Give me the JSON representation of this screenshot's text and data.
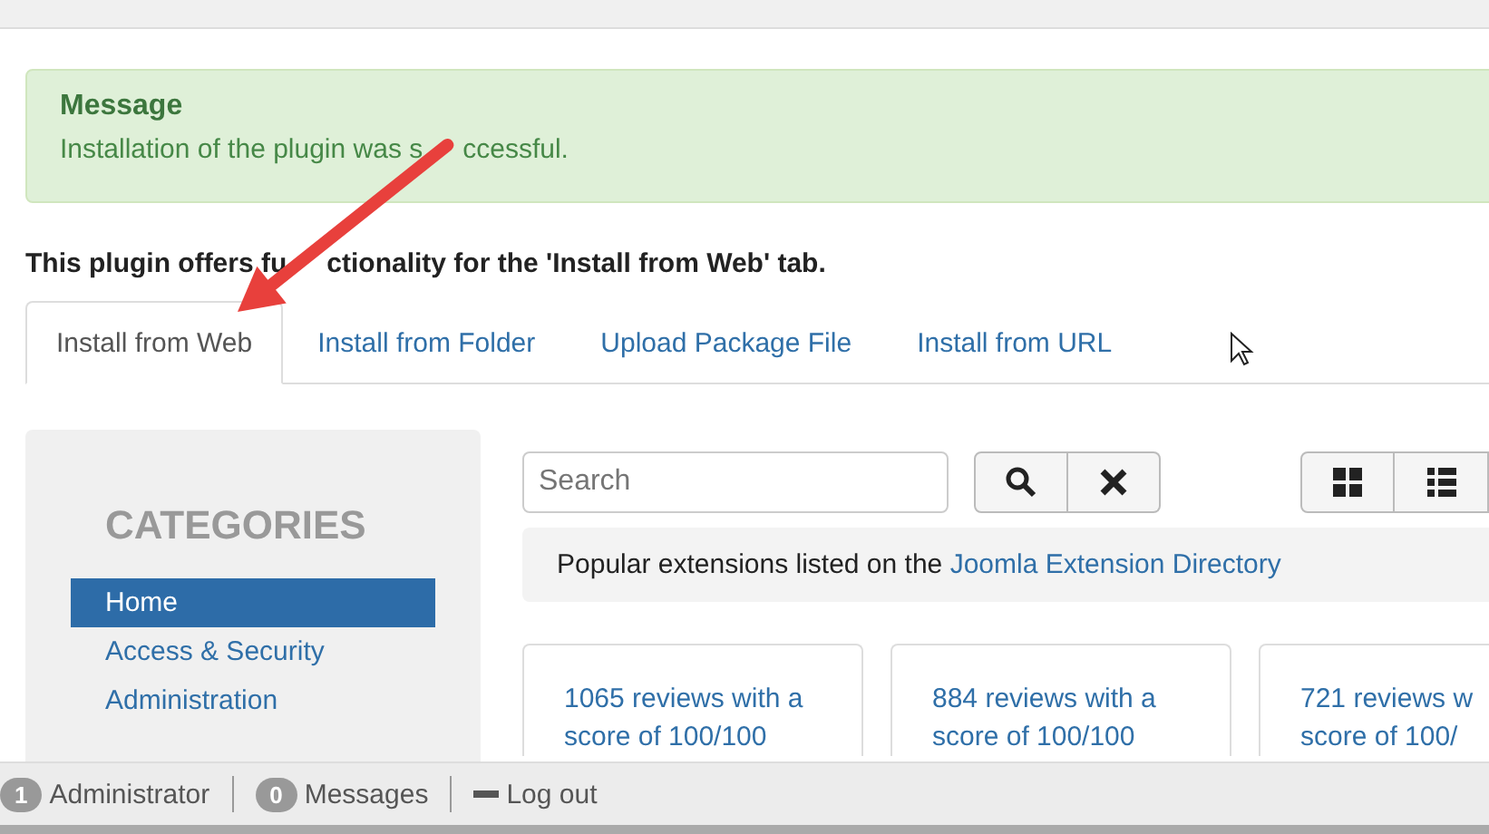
{
  "message": {
    "title": "Message",
    "text_parts": [
      "Installation of the plugin was s",
      "ccessful."
    ]
  },
  "plugin_note_parts": [
    "This plugin offers fu",
    "ctionality for the 'Install from Web' tab."
  ],
  "tabs": [
    {
      "label": "Install from Web",
      "selected": true
    },
    {
      "label": "Install from Folder",
      "selected": false
    },
    {
      "label": "Upload Package File",
      "selected": false
    },
    {
      "label": "Install from URL",
      "selected": false
    }
  ],
  "sidebar": {
    "heading": "CATEGORIES",
    "items": [
      {
        "label": "Home",
        "selected": true
      },
      {
        "label": "Access & Security",
        "selected": false
      },
      {
        "label": "Administration",
        "selected": false
      }
    ]
  },
  "search": {
    "placeholder": "Search"
  },
  "info": {
    "text": "Popular extensions listed on the ",
    "link": "Joomla Extension Directory"
  },
  "cards": [
    {
      "lines": [
        "1065 reviews with a",
        "score of 100/100"
      ]
    },
    {
      "lines": [
        "884 reviews with a",
        "score of 100/100"
      ]
    },
    {
      "lines": [
        "721 reviews w",
        "score of 100/"
      ]
    }
  ],
  "status_bar": [
    {
      "count": "1",
      "label": "Administrator",
      "kind": "badge"
    },
    {
      "count": "0",
      "label": "Messages",
      "kind": "badge"
    },
    {
      "label": "Log out",
      "kind": "logout"
    }
  ]
}
